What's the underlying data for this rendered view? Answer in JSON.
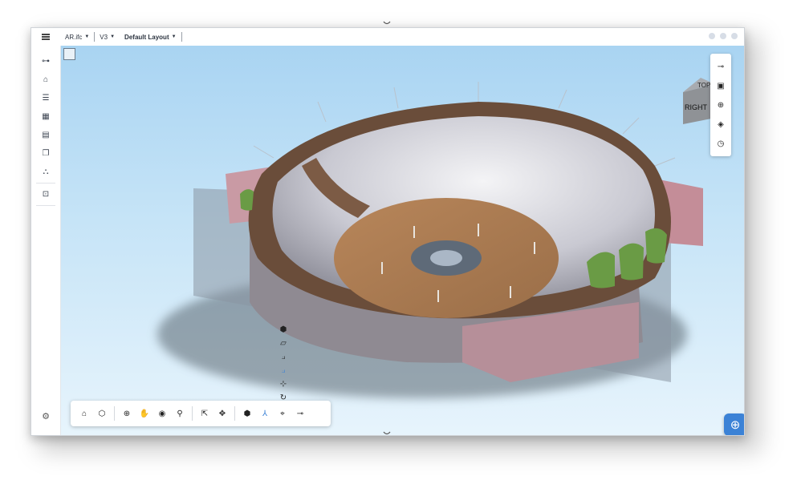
{
  "topbar": {
    "file_name": "AR.ifc",
    "version": "V3",
    "layout": "Default Layout"
  },
  "navcube": {
    "top_label": "TOP",
    "right_label": "RIGHT"
  },
  "sidebar": {
    "items": [
      {
        "icon": "tree-icon"
      },
      {
        "icon": "building-icon"
      },
      {
        "icon": "list-icon"
      },
      {
        "icon": "table-icon"
      },
      {
        "icon": "sheets-icon"
      },
      {
        "icon": "documents-icon"
      },
      {
        "icon": "hierarchy-icon"
      },
      {
        "icon": "issue-icon"
      }
    ],
    "settings_icon": "gear-icon"
  },
  "right_tools": [
    "measure-icon",
    "clip-box-icon",
    "model-icon",
    "section-plane-icon",
    "timer-icon"
  ],
  "vertical_tools": [
    "cube-icon",
    "box-outline-icon",
    "section-axis-icon",
    "section-axis-active-icon",
    "plane-rotate-icon",
    "orbit-icon"
  ],
  "bottom_toolbar": [
    "home-icon",
    "cube-view-icon",
    "zoom-icon",
    "pan-hand-icon",
    "camera-icon",
    "pin-icon",
    "select-icon",
    "move-icon",
    "explode-icon",
    "axis-icon",
    "clip-icon",
    "measure-icon"
  ],
  "colors": {
    "accent": "#3b82d6",
    "sky_top": "#a9d4f2",
    "sky_bottom": "#e7f4fc"
  }
}
